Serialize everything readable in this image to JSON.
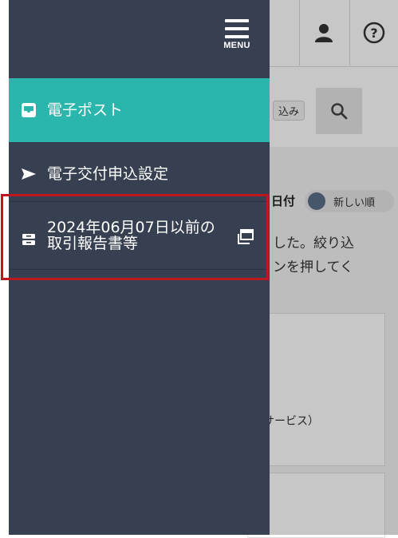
{
  "menu": {
    "label": "MENU"
  },
  "nav": {
    "items": [
      {
        "label": "電子ポスト",
        "icon": "inbox-icon",
        "active": true
      },
      {
        "label": "電子交付申込設定",
        "icon": "send-icon"
      },
      {
        "label_line1": "2024年06月07日以前の",
        "label_line2": "取引報告書等",
        "icon": "archive-icon",
        "trailing_icon": "open-new-window-icon"
      }
    ]
  },
  "background": {
    "search_tag": "込み",
    "sort_label": "日付",
    "sort_toggle": "新しい順",
    "text_line1": "した。絞り込",
    "text_line2": "ンを押してく",
    "service_text": "サービス）"
  },
  "colors": {
    "drawer_bg": "#364051",
    "active_item_bg": "#2bb6ad",
    "highlight_border": "#c0161d"
  }
}
